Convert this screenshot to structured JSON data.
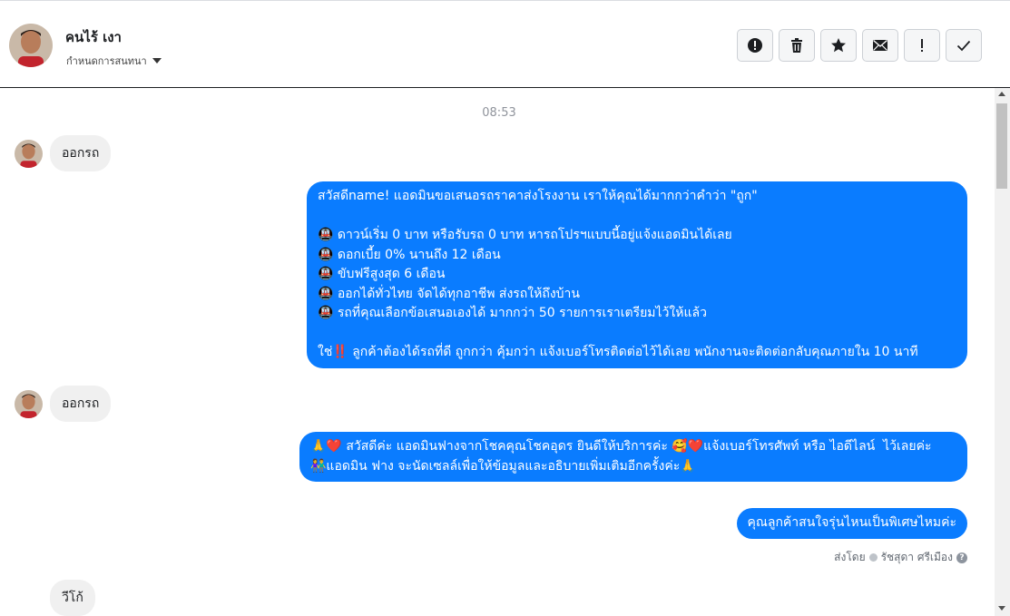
{
  "header": {
    "contact_name": "คนไร้ เงา",
    "assign_label": "กำหนดการสนทนา",
    "actions": [
      "spam-report",
      "delete",
      "star",
      "mark-unread",
      "follow-up",
      "done"
    ]
  },
  "thread": {
    "timestamp": "08:53",
    "messages": [
      {
        "dir": "in",
        "text": "ออกรถ"
      },
      {
        "dir": "out",
        "text": "สวัสดีname! แอดมินขอเสนอรถราคาส่งโรงงาน เราให้คุณได้มากกว่าคำว่า \"ถูก\"\n\n🚇 ดาวน์เริ่ม 0 บาท หรือรับรถ 0 บาท หารถโปรฯแบบนี้อยู่แจ้งแอดมินได้เลย\n🚇 ดอกเบี้ย 0% นานถึง 12 เดือน\n🚇 ขับฟรีสูงสุด 6 เดือน\n🚇 ออกได้ทั่วไทย จัดได้ทุกอาชีพ ส่งรถให้ถึงบ้าน\n🚇 รถที่คุณเลือกข้อเสนอเองได้ มากกว่า 50 รายการเราเตรียมไว้ให้แล้ว\n\nใช่‼️ ลูกค้าต้องได้รถที่ดี ถูกกว่า คุ้มกว่า แจ้งเบอร์โทรติดต่อไว้ได้เลย พนักงานจะติดต่อกลับคุณภายใน 10 นาที"
      },
      {
        "dir": "in",
        "text": "ออกรถ"
      },
      {
        "dir": "out",
        "text": "🙏❤️ สวัสดีค่ะ แอดมินฟางจากโชคคุณโชคอุดร ยินดีให้บริการค่ะ 🥰❤️แจ้งเบอร์โทรศัพท์ หรือ ไอดีไลน์  ไว้เลยค่ะ\n👫แอดมิน ฟาง จะนัดเซลล์เพื่อให้ข้อมูลและอธิบายเพิ่มเติมอีกครั้งค่ะ🙏"
      },
      {
        "dir": "out",
        "text": "คุณลูกค้าสนใจรุ่นไหนเป็นพิเศษไหมค่ะ"
      },
      {
        "dir": "in",
        "text": "วีโก้"
      }
    ],
    "sent_by_label": "ส่งโดย",
    "sent_by_name": "รัชสุดา ศรีเมือง"
  },
  "colors": {
    "accent": "#0a7cff",
    "incoming_bubble": "#f0f0f0"
  }
}
